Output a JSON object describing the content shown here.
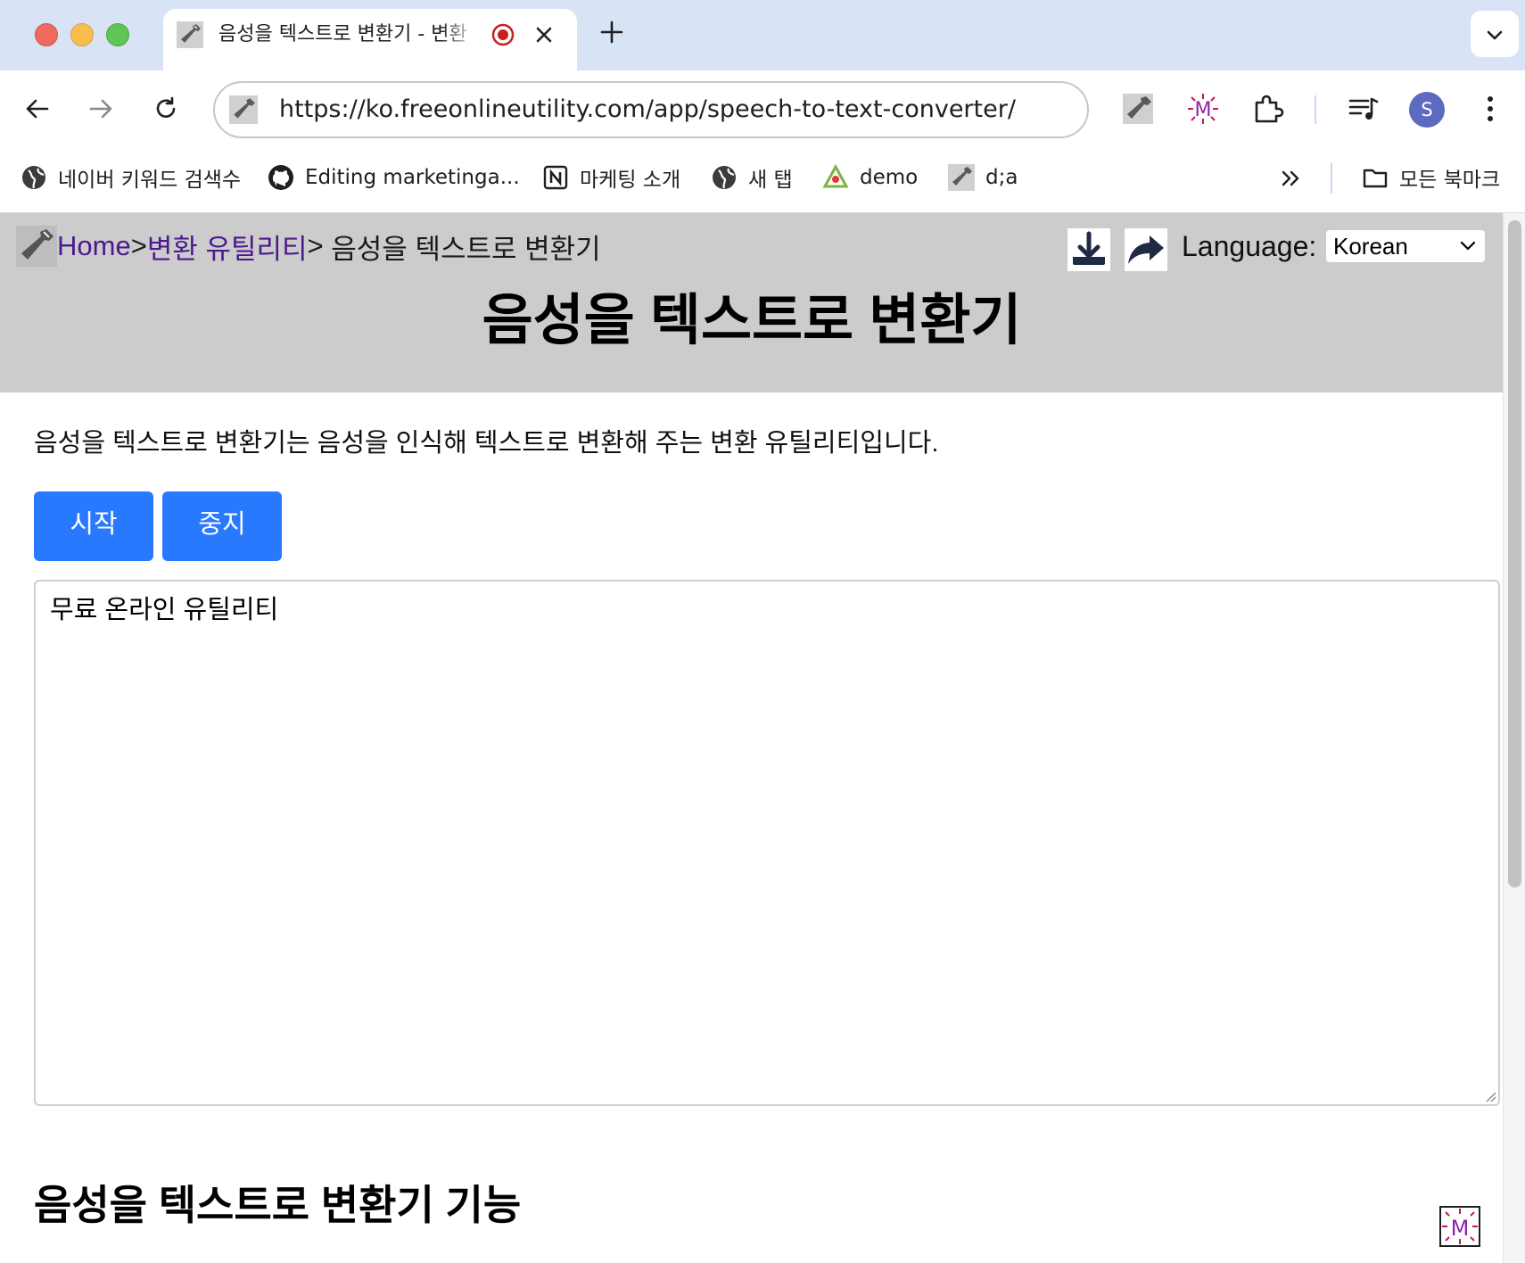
{
  "browser": {
    "tab": {
      "title": "음성을 텍스트로 변환기 - 변환"
    },
    "address_bar": {
      "url": "https://ko.freeonlineutility.com/app/speech-to-text-converter/"
    },
    "profile_initial": "S",
    "bookmarks": [
      {
        "label": "네이버 키워드 검색수",
        "icon": "globe-icon"
      },
      {
        "label": "Editing marketinga...",
        "icon": "github-icon"
      },
      {
        "label": "마케팅 소개",
        "icon": "notion-icon"
      },
      {
        "label": "새 탭",
        "icon": "globe-icon"
      },
      {
        "label": "demo",
        "icon": "recycle-icon"
      },
      {
        "label": "d;a",
        "icon": "wrench-icon"
      }
    ],
    "all_bookmarks_label": "모든 북마크"
  },
  "page": {
    "breadcrumb": {
      "home": "Home",
      "sep1": ">",
      "category": "변환 유틸리티",
      "sep2": ">",
      "current": " 음성을 텍스트로 변환기"
    },
    "language": {
      "label": "Language:",
      "selected": "Korean"
    },
    "title": "음성을 텍스트로 변환기",
    "description": "음성을 텍스트로 변환기는 음성을 인식해 텍스트로 변환해 주는 변환 유틸리티입니다.",
    "buttons": {
      "start": "시작",
      "stop": "중지"
    },
    "textarea_value": "무료 온라인 유틸리티",
    "section_heading": "음성을 텍스트로 변환기 기능"
  },
  "colors": {
    "tab_strip": "#d9e3f6",
    "header_bg": "#cccccc",
    "button_blue": "#2979ff",
    "link_purple": "#4b1a8c"
  }
}
